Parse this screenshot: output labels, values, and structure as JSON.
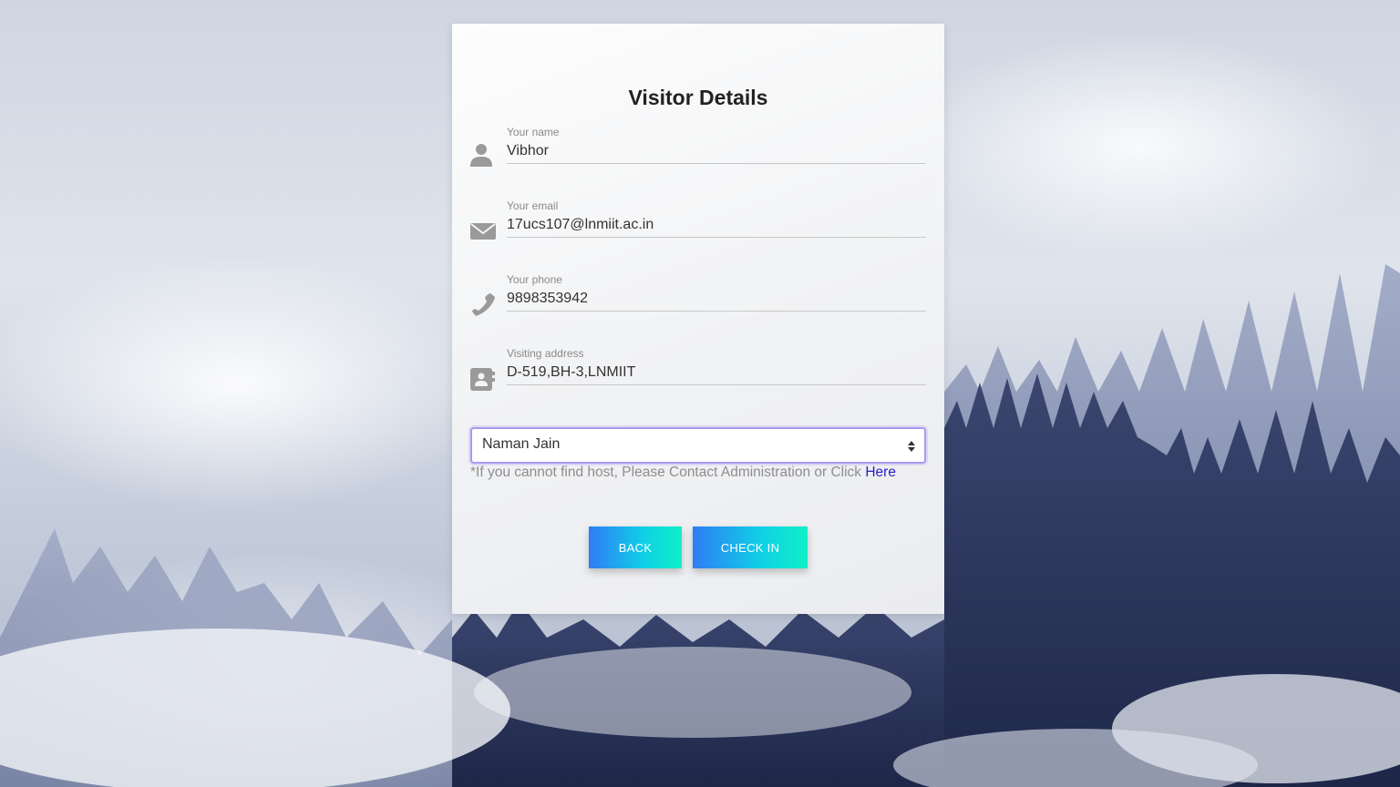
{
  "form": {
    "title": "Visitor Details",
    "fields": [
      {
        "label": "Your name",
        "value": "Vibhor",
        "icon": "person-icon"
      },
      {
        "label": "Your email",
        "value": "17ucs107@lnmiit.ac.in",
        "icon": "envelope-icon"
      },
      {
        "label": "Your phone",
        "value": "9898353942",
        "icon": "phone-icon"
      },
      {
        "label": "Visiting address",
        "value": "D-519,BH-3,LNMIIT",
        "icon": "address-book-icon"
      }
    ],
    "host_select": {
      "selected": "Naman Jain",
      "accent_color": "#a99af0"
    },
    "note": {
      "text": "*If you cannot find host, Please Contact Administration or Click ",
      "link_text": "Here",
      "link_color": "#2a1ec6"
    },
    "buttons": {
      "back_label": "BACK",
      "check_in_label": "CHECK IN"
    }
  }
}
